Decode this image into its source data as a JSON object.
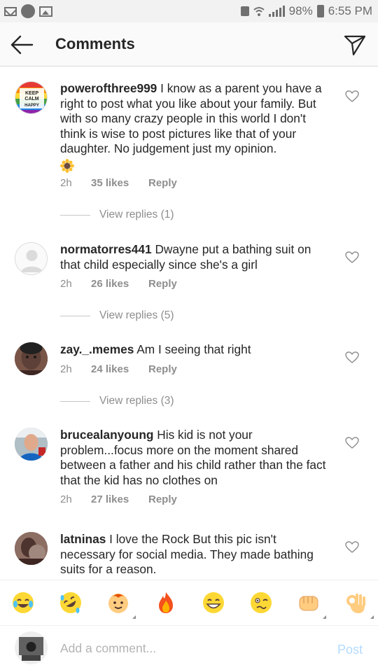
{
  "status_bar": {
    "battery_text": "98%",
    "time": "6:55 PM"
  },
  "header": {
    "title": "Comments",
    "back_icon": "arrow-left-icon",
    "share_icon": "paper-plane-icon"
  },
  "comments": [
    {
      "username": "powerofthree999",
      "text": "I know as a parent you have a right to post what you like about your family. But with so many crazy people in this world I don't think is wise to post pictures like that of your daughter. No judgement just my opinion.",
      "time": "2h",
      "likes": "35 likes",
      "reply": "Reply",
      "view_replies": "View replies (1)",
      "avatar": "keep-calm-rainbow-avatar"
    },
    {
      "username": "normatorres441",
      "text": "Dwayne put a bathing suit on that child especially since she's a girl",
      "time": "2h",
      "likes": "26 likes",
      "reply": "Reply",
      "view_replies": "View replies (5)",
      "avatar": "default-avatar"
    },
    {
      "username": "zay._.memes",
      "text": "Am I seeing that right",
      "time": "2h",
      "likes": "24 likes",
      "reply": "Reply",
      "view_replies": "View replies (3)",
      "avatar": "photo-avatar"
    },
    {
      "username": "brucealanyoung",
      "text": "His kid is not your problem...focus more on the moment shared between a father and his child rather than the fact that the kid has no clothes on",
      "time": "2h",
      "likes": "27 likes",
      "reply": "Reply",
      "avatar": "photo-avatar"
    },
    {
      "username": "latninas",
      "text": "I love the Rock But this pic isn't necessary for social media. They made bathing suits for a reason.",
      "avatar": "photo-avatar"
    }
  ],
  "emoji_bar": [
    "face-with-tears-of-joy",
    "rolling-on-floor-laughing",
    "baby-face",
    "fire",
    "grinning-squinting",
    "woozy-face",
    "oncoming-fist",
    "ok-hand"
  ],
  "input": {
    "placeholder": "Add a comment...",
    "post_label": "Post"
  },
  "colors": {
    "accent": "#3897f0",
    "post_disabled": "#b3dbff",
    "muted": "#8e8e8e",
    "text": "#262626"
  }
}
